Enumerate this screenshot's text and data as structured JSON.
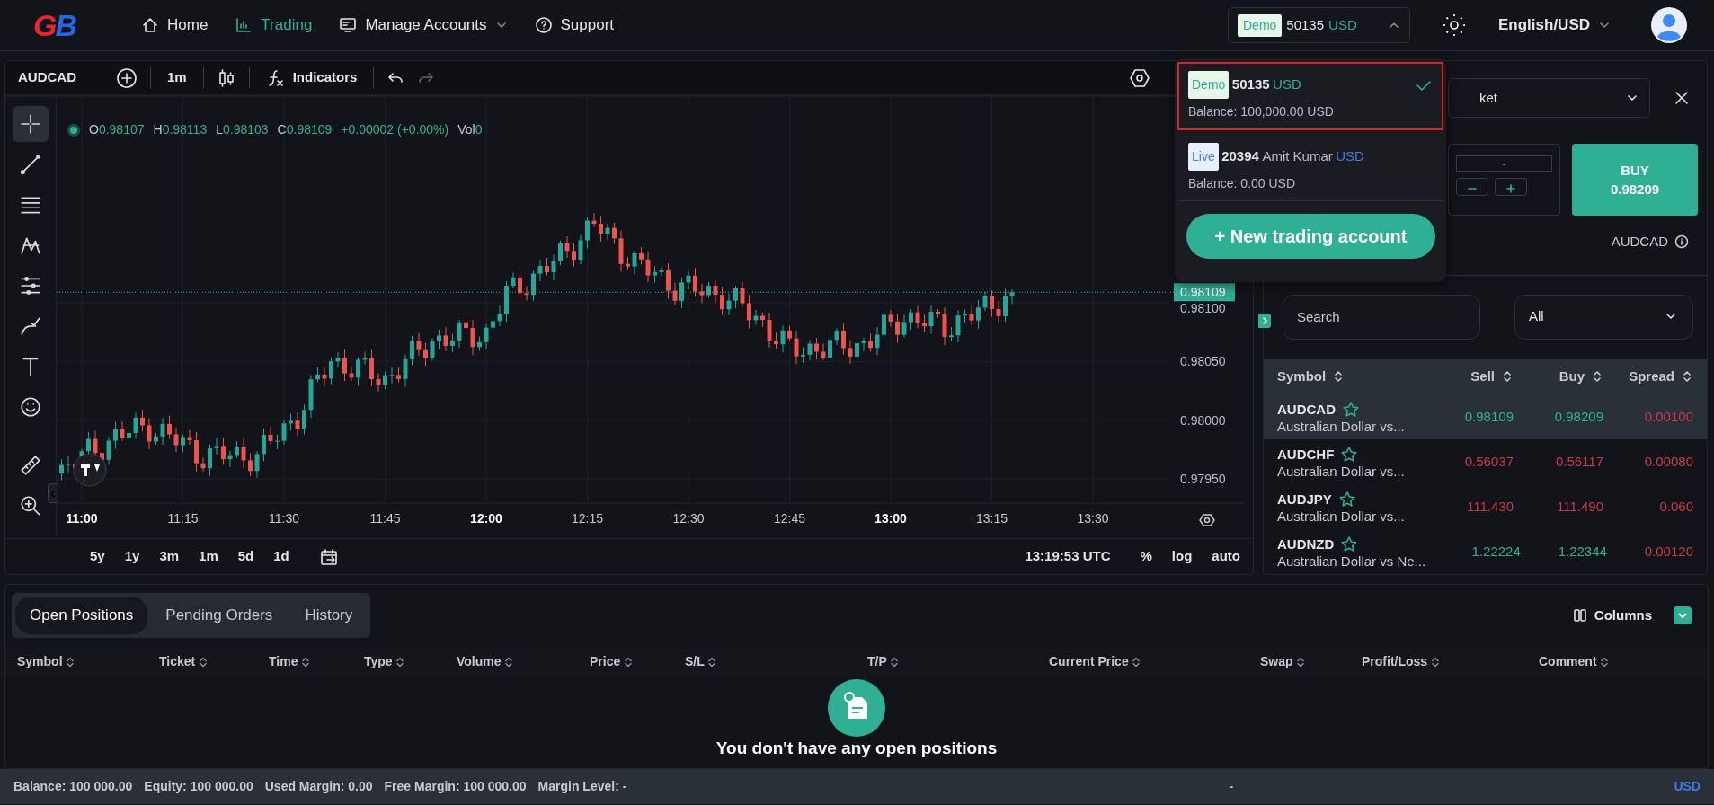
{
  "header": {
    "logo": [
      {
        "text": "G",
        "color": "#e8262c"
      },
      {
        "text": "B",
        "color": "#2866e0"
      }
    ],
    "nav": [
      {
        "label": "Home",
        "kind": "home",
        "selected": false,
        "has_menu": false
      },
      {
        "label": "Trading",
        "kind": "chart",
        "selected": true,
        "has_menu": false
      },
      {
        "label": "Manage Accounts",
        "kind": "accounts",
        "selected": false,
        "has_menu": true
      },
      {
        "label": "Support",
        "kind": "help",
        "selected": false,
        "has_menu": false
      }
    ],
    "account": {
      "type": "Demo",
      "number": "50135",
      "currency": "USD",
      "expanded": true
    },
    "language": "English/USD"
  },
  "chart": {
    "symbol": "AUDCAD",
    "interval": "1m",
    "indicators": "Indicators",
    "ohlc": [
      {
        "label": "O",
        "value": "0.98107"
      },
      {
        "label": "H",
        "value": "0.98113"
      },
      {
        "label": "L",
        "value": "0.98103"
      },
      {
        "label": "C",
        "value": "0.98109"
      }
    ],
    "change": "+0.00002 (+0.00%)",
    "volume_label": "Vol",
    "volume": "0",
    "tools": [
      {
        "kind": "crosshair",
        "selected": true
      },
      {
        "kind": "line",
        "selected": false
      },
      {
        "kind": "lines",
        "selected": false
      },
      {
        "kind": "pattern",
        "selected": false
      },
      {
        "kind": "levels",
        "selected": false
      },
      {
        "kind": "brush",
        "selected": false
      },
      {
        "kind": "text",
        "selected": false
      },
      {
        "kind": "smiley",
        "selected": false
      },
      {
        "kind": "ruler",
        "selected": false
      },
      {
        "kind": "zoom",
        "selected": false
      }
    ],
    "price_ticks": [
      "0.98100",
      "0.98050",
      "0.98000",
      "0.97950"
    ],
    "last_price": "0.98109",
    "time_ticks": [
      {
        "label": "11:00",
        "bold": true
      },
      {
        "label": "11:15",
        "bold": false
      },
      {
        "label": "11:30",
        "bold": false
      },
      {
        "label": "11:45",
        "bold": false
      },
      {
        "label": "12:00",
        "bold": true
      },
      {
        "label": "12:15",
        "bold": false
      },
      {
        "label": "12:30",
        "bold": false
      },
      {
        "label": "12:45",
        "bold": false
      },
      {
        "label": "13:00",
        "bold": true
      },
      {
        "label": "13:15",
        "bold": false
      },
      {
        "label": "13:30",
        "bold": false
      }
    ],
    "ranges": [
      "5y",
      "1y",
      "3m",
      "1m",
      "5d",
      "1d"
    ],
    "clock": "13:19:53 UTC",
    "scale_options": [
      "%",
      "log",
      "auto"
    ]
  },
  "order_panel": {
    "order_type": "ket",
    "volume": "-",
    "buy_label": "BUY",
    "buy_price": "0.98209",
    "symbol": "AUDCAD"
  },
  "account_menu": {
    "accounts": [
      {
        "kind": "demo",
        "type": "Demo",
        "number": "50135",
        "currency": "USD",
        "balance": "Balance: 100,000.00 USD",
        "selected": true
      },
      {
        "kind": "live",
        "type": "Live",
        "number": "20394",
        "holder": "Amit Kumar",
        "currency": "USD",
        "balance": "Balance: 0.00 USD",
        "selected": false
      }
    ],
    "new_account": "+ New trading account"
  },
  "market_watch": {
    "search_placeholder": "Search",
    "filter": "All",
    "columns": [
      "Symbol",
      "Sell",
      "Buy",
      "Spread"
    ],
    "rows": [
      {
        "symbol": "AUDCAD",
        "description": "Australian Dollar vs...",
        "sell": "0.98109",
        "buy": "0.98209",
        "spread": "0.00100",
        "color": "#2fb095",
        "selected": true
      },
      {
        "symbol": "AUDCHF",
        "description": "Australian Dollar vs...",
        "sell": "0.56037",
        "buy": "0.56117",
        "spread": "0.00080",
        "color": "#c83a4c",
        "selected": false
      },
      {
        "symbol": "AUDJPY",
        "description": "Australian Dollar vs...",
        "sell": "111.430",
        "buy": "111.490",
        "spread": "0.060",
        "color": "#c83a4c",
        "selected": false
      },
      {
        "symbol": "AUDNZD",
        "description": "Australian Dollar vs Ne...",
        "sell": "1.22224",
        "buy": "1.22344",
        "spread": "0.00120",
        "color": "#2fb095",
        "selected": false
      }
    ]
  },
  "positions": {
    "tabs": [
      {
        "label": "Open Positions",
        "selected": true
      },
      {
        "label": "Pending Orders",
        "selected": false
      },
      {
        "label": "History",
        "selected": false
      }
    ],
    "columns_button": "Columns",
    "columns": [
      "Symbol",
      "Ticket",
      "Time",
      "Type",
      "Volume",
      "Price",
      "S/L",
      "T/P",
      "Current Price",
      "Swap",
      "Profit/Loss",
      "Comment"
    ],
    "empty_message": "You don't have any open positions"
  },
  "status_bar": {
    "items": [
      "Balance: 100 000.00",
      "Equity: 100 000.00",
      "Used Margin: 0.00",
      "Free Margin: 100 000.00",
      "Margin Level: -"
    ],
    "center": "-",
    "currency": "USD"
  }
}
